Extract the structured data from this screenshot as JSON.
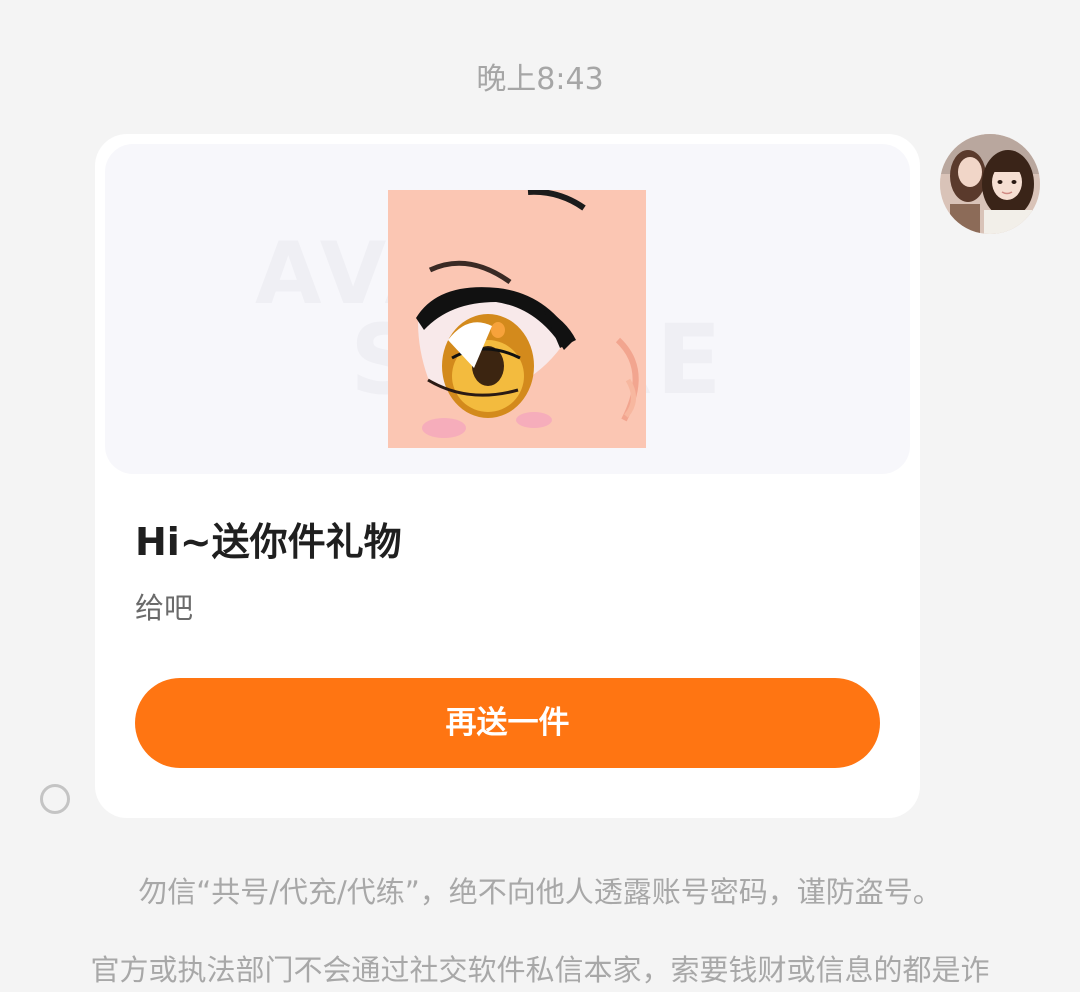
{
  "chat": {
    "timestamp": "晚上8:43"
  },
  "gift_card": {
    "banner_bg_text_top": "AVATAR",
    "banner_bg_text_bottom": "STORE",
    "image_icon": "anime-eye-image",
    "title": "Hi~送你件礼物",
    "subtitle": "给吧",
    "button_label": "再送一件",
    "button_color": "#ff7512"
  },
  "notices": {
    "line1": "勿信“共号/代充/代练”，绝不向他人透露账号密码，谨防盗号。",
    "line2": "官方或执法部门不会通过社交软件私信本家，索要钱财或信息的都是诈"
  },
  "colors": {
    "background": "#f4f4f4",
    "card": "#ffffff",
    "accent": "#ff7512"
  }
}
